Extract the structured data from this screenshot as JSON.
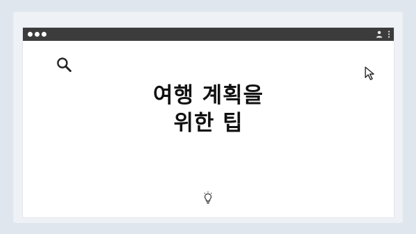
{
  "page": {
    "title_line1": "여행 계획을",
    "title_line2": "위한 팁"
  },
  "icons": {
    "search": "search-icon",
    "cursor": "cursor-icon",
    "lightbulb": "lightbulb-icon",
    "user": "user-icon",
    "menu": "kebab-menu-icon"
  },
  "colors": {
    "background": "#dfe6ee",
    "titlebar": "#3c3c3c",
    "window": "#ffffff",
    "text": "#111111"
  }
}
